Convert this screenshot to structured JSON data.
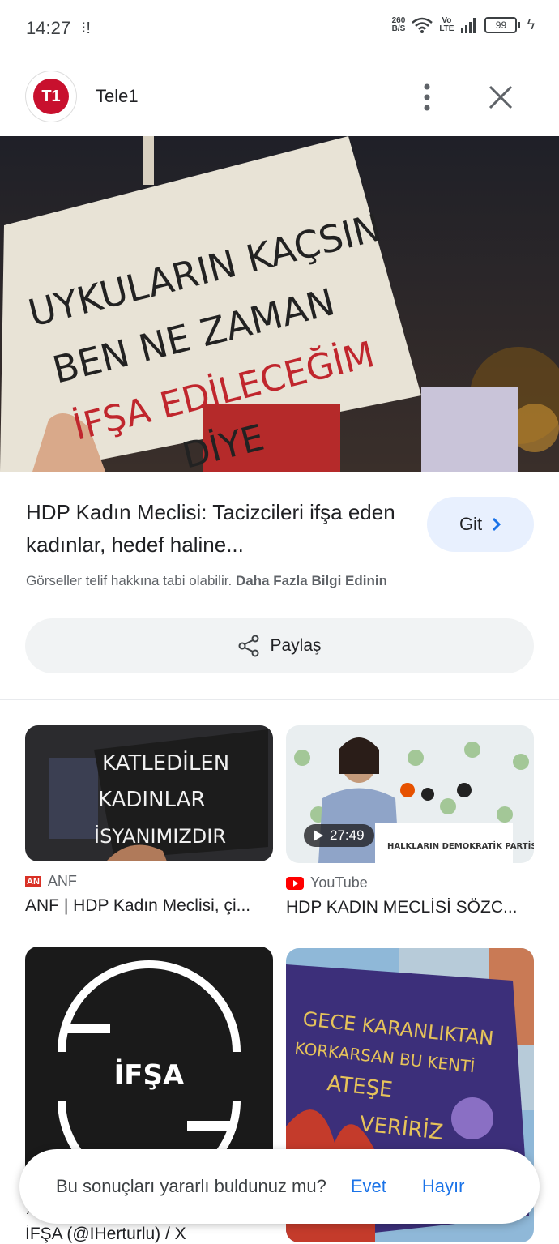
{
  "status": {
    "time": "14:27",
    "net_rate_top": "260",
    "net_rate_bottom": "B/S",
    "lte_top": "Vo",
    "lte_bottom": "LTE",
    "battery": "99"
  },
  "header": {
    "source_name": "Tele1",
    "logo_text": "T1"
  },
  "hero": {
    "sign_lines": [
      "UYKULARIN KAÇSIN",
      "BEN NE ZAMAN",
      "İFŞA EDİLECEĞİM",
      "DİYE"
    ]
  },
  "result": {
    "title": "HDP Kadın Meclisi: Tacizcileri ifşa eden kadınlar, hedef haline...",
    "go_label": "Git",
    "copyright_text": "Görseller telif hakkına tabi olabilir.",
    "learn_more": "Daha Fazla Bilgi Edinin",
    "share_label": "Paylaş"
  },
  "related": [
    {
      "source": "ANF",
      "source_icon_text": "AN",
      "caption": "ANF | HDP Kadın Meclisi, çi...",
      "sign_lines": [
        "KATLEDİLEN",
        "KADINLAR",
        "İSYANIMIZDIR"
      ]
    },
    {
      "source": "YouTube",
      "caption": "HDP KADIN MECLİSİ SÖZC...",
      "duration": "27:49",
      "podium_text": "HALKLARIN DEMOKRATİK PARTİSİ"
    },
    {
      "source": "X",
      "caption": "İFŞA (@IHerturlu) / X",
      "logo_text": "İFŞA"
    },
    {
      "source": "",
      "caption": "",
      "sign_lines": [
        "GECE KARANLIKTAN",
        "KORKARSAN BU KENTİ",
        "ATEŞE",
        "VERİRİZ"
      ]
    }
  ],
  "feedback": {
    "question": "Bu sonuçları yararlı buldunuz mu?",
    "yes": "Evet",
    "no": "Hayır"
  }
}
